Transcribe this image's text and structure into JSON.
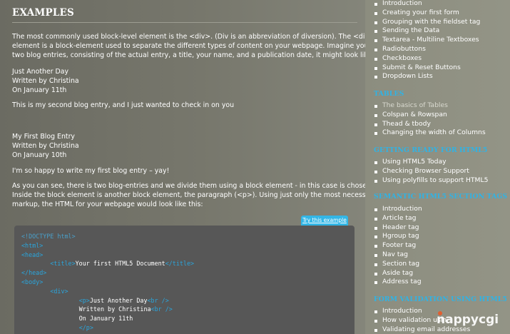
{
  "main": {
    "heading": "EXAMPLES",
    "intro": [
      "The most commonly used block-level element is the <div>. (Div is an abbreviation of diversion). The <div>",
      "element is a block-element used to separate the different types of content on your webpage. Imagine you have",
      "two blog entries, consisting of the actual entry, a title, your name, and a publication date, it might look like this:"
    ],
    "entry1_meta": [
      "Just Another Day",
      "Written by Christina",
      "On January 11th"
    ],
    "entry1_body": "This is my second blog entry, and I just wanted to check in on you",
    "entry2_meta": [
      "My First Blog Entry",
      "Written by Christina",
      "On January 10th"
    ],
    "entry2_body": "I'm so happy to write my first blog entry – yay!",
    "explanation": [
      "As you can see, there is two blog-entries and we divide them using a block element - in this case is chose a <div>.",
      "Inside the block element is another block element, the paragraph (<p>). Using just only the most necessary",
      "markup, the HTML for your webpage would look like this:"
    ],
    "try_button": "Try this example",
    "code": {
      "l1": "<!DOCTYPE html>",
      "l2": "<html>",
      "l3": "<head>",
      "l4_open": "<title>",
      "l4_text": "Your first HTML5 Document",
      "l4_close": "</title>",
      "l5": "</head>",
      "l6": "<body>",
      "l7": "<div>",
      "l8_open": "<p>",
      "l8_text": "Just Another Day",
      "l8_br": "<br />",
      "l9_text": "Written by Christina",
      "l9_br": "<br />",
      "l10_text": "On January 11th",
      "l11": "</p>"
    }
  },
  "sidebar": {
    "forms_items": [
      "Introduction",
      "Creating your first form",
      "Grouping with the fieldset tag",
      "Sending the Data",
      "Textarea - Multiline Textboxes",
      "Radiobuttons",
      "Checkboxes",
      "Submit & Reset Buttons",
      "Dropdown Lists"
    ],
    "tables": {
      "title": "TABLES",
      "items": [
        "The basics of Tables",
        "Colspan & Rowspan",
        "Thead & tbody",
        "Changing the width of Columns"
      ]
    },
    "getting_ready": {
      "title": "GETTING READY FOR HTML5",
      "items": [
        "Using HTML5 Today",
        "Checking Browser Support",
        "Using polyfills to support HTML5"
      ]
    },
    "semantic": {
      "title": "SEMANTIC HTML5 SECTION TAGS",
      "items": [
        "Introduction",
        "Article tag",
        "Header tag",
        "Hgroup tag",
        "Footer tag",
        "Nav tag",
        "Section tag",
        "Aside tag",
        "Address tag"
      ]
    },
    "form_validation": {
      "title": "FORM VALIDATION USING HTML5",
      "items": [
        "Introduction",
        "How validation usin",
        "Validating email addresses"
      ]
    }
  },
  "logo": {
    "text": "nappycgi",
    "accent": "#e85b2a"
  },
  "colors": {
    "accent": "#30b3e5",
    "code_bg": "#575757",
    "tag": "#2aa5dc"
  }
}
